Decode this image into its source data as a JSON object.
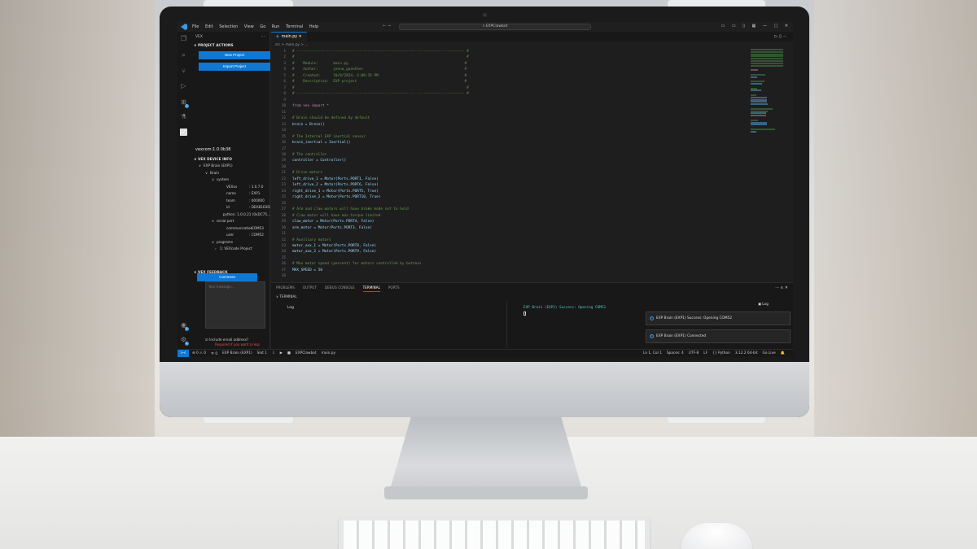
{
  "titlebar": {
    "menu": [
      "File",
      "Edit",
      "Selection",
      "View",
      "Go",
      "Run",
      "Terminal",
      "Help"
    ],
    "search": "EXPClawbot",
    "nav_arrows": "←  →",
    "window_controls": [
      "▭",
      "▭",
      "▯",
      "▦",
      "—",
      "▢",
      "✕"
    ]
  },
  "sidebar": {
    "title": "VEX",
    "more": "···",
    "project_actions_header": "PROJECT ACTIONS",
    "new_project": "New Project",
    "import_project": "Import Project",
    "vexcom": "vexcom:1.0.0b38",
    "device_info_header": "VEX DEVICE INFO",
    "device_tree": [
      {
        "indent": 10,
        "arrow": "∨",
        "label": "EXP Brain (EXP1)",
        "value": ""
      },
      {
        "indent": 18,
        "arrow": "∨",
        "label": "Brain",
        "value": ""
      },
      {
        "indent": 26,
        "arrow": "∨",
        "label": "system",
        "value": ""
      },
      {
        "indent": 38,
        "arrow": "",
        "label": "VEXos",
        "value": ": 1.0.7.0"
      },
      {
        "indent": 38,
        "arrow": "",
        "label": "name",
        "value": ": EXP1"
      },
      {
        "indent": 38,
        "arrow": "",
        "label": "team",
        "value": ": 000000"
      },
      {
        "indent": 38,
        "arrow": "",
        "label": "id",
        "value": ": DEAB1E0D"
      },
      {
        "indent": 38,
        "arrow": "",
        "label": "python",
        "value": ": 1.0.0.21 (0xDC75..."
      },
      {
        "indent": 26,
        "arrow": "∨",
        "label": "serial port",
        "value": ""
      },
      {
        "indent": 38,
        "arrow": "",
        "label": "communication",
        "value": ": COM53"
      },
      {
        "indent": 38,
        "arrow": "",
        "label": "user",
        "value": ": COM52"
      },
      {
        "indent": 26,
        "arrow": "∨",
        "label": "programs",
        "value": ""
      },
      {
        "indent": 30,
        "arrow": "›",
        "label": "1:   VEXcode Project",
        "value": ""
      }
    ],
    "feedback_header": "VEX FEEDBACK",
    "comment_button": "Comment",
    "message_placeholder": "Your message...",
    "include_email": "Include email address?",
    "required_note": "Required if you want a resp"
  },
  "editor": {
    "tab_label": "main.py",
    "breadcrumb": "src  >  main.py  >  ...",
    "code_lines": [
      {
        "n": "1",
        "t": "# ------------------------------------------------------------------------------ #",
        "c": "c-com"
      },
      {
        "n": "2",
        "t": "#                                                                                #",
        "c": "c-com"
      },
      {
        "n": "3",
        "t": "#    Module:       main.py                                                      #",
        "c": "c-com"
      },
      {
        "n": "4",
        "t": "#    Author:       jenna_guenther                                               #",
        "c": "c-com"
      },
      {
        "n": "5",
        "t": "#    Created:      10/8/2024, 4:00:35 PM                                        #",
        "c": "c-com"
      },
      {
        "n": "6",
        "t": "#    Description:  EXP project                                                  #",
        "c": "c-com"
      },
      {
        "n": "7",
        "t": "#                                                                                #",
        "c": "c-com"
      },
      {
        "n": "8",
        "t": "# ------------------------------------------------------------------------------ #",
        "c": "c-com"
      },
      {
        "n": "9",
        "t": "",
        "c": ""
      },
      {
        "n": "10",
        "t": "from vex import *",
        "c": "c-kw"
      },
      {
        "n": "11",
        "t": "",
        "c": ""
      },
      {
        "n": "12",
        "t": "# Brain should be defined by default",
        "c": "c-com"
      },
      {
        "n": "13",
        "t": "brain = Brain()",
        "c": "c-var"
      },
      {
        "n": "14",
        "t": "",
        "c": ""
      },
      {
        "n": "15",
        "t": "# The Internal EXP inertial sensor",
        "c": "c-com"
      },
      {
        "n": "16",
        "t": "brain_inertial = Inertial()",
        "c": "c-var"
      },
      {
        "n": "17",
        "t": "",
        "c": ""
      },
      {
        "n": "18",
        "t": "# The controller",
        "c": "c-com"
      },
      {
        "n": "19",
        "t": "controller = Controller()",
        "c": "c-var"
      },
      {
        "n": "20",
        "t": "",
        "c": ""
      },
      {
        "n": "21",
        "t": "# Drive motors",
        "c": "c-com"
      },
      {
        "n": "22",
        "t": "left_drive_1 = Motor(Ports.PORT1, False)",
        "c": "c-var"
      },
      {
        "n": "23",
        "t": "left_drive_2 = Motor(Ports.PORT6, False)",
        "c": "c-var"
      },
      {
        "n": "24",
        "t": "right_drive_1 = Motor(Ports.PORT5, True)",
        "c": "c-var"
      },
      {
        "n": "25",
        "t": "right_drive_2 = Motor(Ports.PORT10, True)",
        "c": "c-var"
      },
      {
        "n": "26",
        "t": "",
        "c": ""
      },
      {
        "n": "27",
        "t": "# Arm and claw motors will have brake mode set to hold",
        "c": "c-com"
      },
      {
        "n": "28",
        "t": "# Claw motor will have max torque limited",
        "c": "c-com"
      },
      {
        "n": "29",
        "t": "claw_motor = Motor(Ports.PORT4, False)",
        "c": "c-var"
      },
      {
        "n": "30",
        "t": "arm_motor = Motor(Ports.PORT3, False)",
        "c": "c-var"
      },
      {
        "n": "31",
        "t": "",
        "c": ""
      },
      {
        "n": "32",
        "t": "# Auxiliary motors",
        "c": "c-com"
      },
      {
        "n": "33",
        "t": "motor_aux_1 = Motor(Ports.PORT8, False)",
        "c": "c-var"
      },
      {
        "n": "34",
        "t": "motor_aux_2 = Motor(Ports.PORT9, False)",
        "c": "c-var"
      },
      {
        "n": "35",
        "t": "",
        "c": ""
      },
      {
        "n": "36",
        "t": "# Max motor speed (percent) for motors controlled by buttons",
        "c": "c-com"
      },
      {
        "n": "37",
        "t": "MAX_SPEED = 50",
        "c": "c-var"
      },
      {
        "n": "38",
        "t": "",
        "c": ""
      }
    ]
  },
  "panel": {
    "tabs": [
      "PROBLEMS",
      "OUTPUT",
      "DEBUG CONSOLE",
      "TERMINAL",
      "PORTS"
    ],
    "active_tab": "TERMINAL",
    "terminal_header": "∨ TERMINAL",
    "log_label": "Log",
    "terminal_message": "EXP Brain (EXP1) Success: Opening COM53",
    "log_tab": "Log",
    "toasts": [
      "EXP Brain (EXP1) Success: Opening COM52",
      "EXP Brain (EXP1) Connected"
    ],
    "controls": "···  ∧  ✕"
  },
  "statusbar": {
    "remote": "><",
    "left": [
      "⊗ 0 ⚠ 0",
      "ᯤ 0",
      "EXP Brain (EXP1)",
      "Slot 1",
      "⇩",
      "▶",
      "■",
      "EXPClawbot",
      "main.py"
    ],
    "right": [
      "Ln 1, Col 1",
      "Spaces: 4",
      "UTF-8",
      "LF",
      "{} Python",
      "3.12.2 64-bit",
      "Go Live",
      "🔔"
    ]
  }
}
